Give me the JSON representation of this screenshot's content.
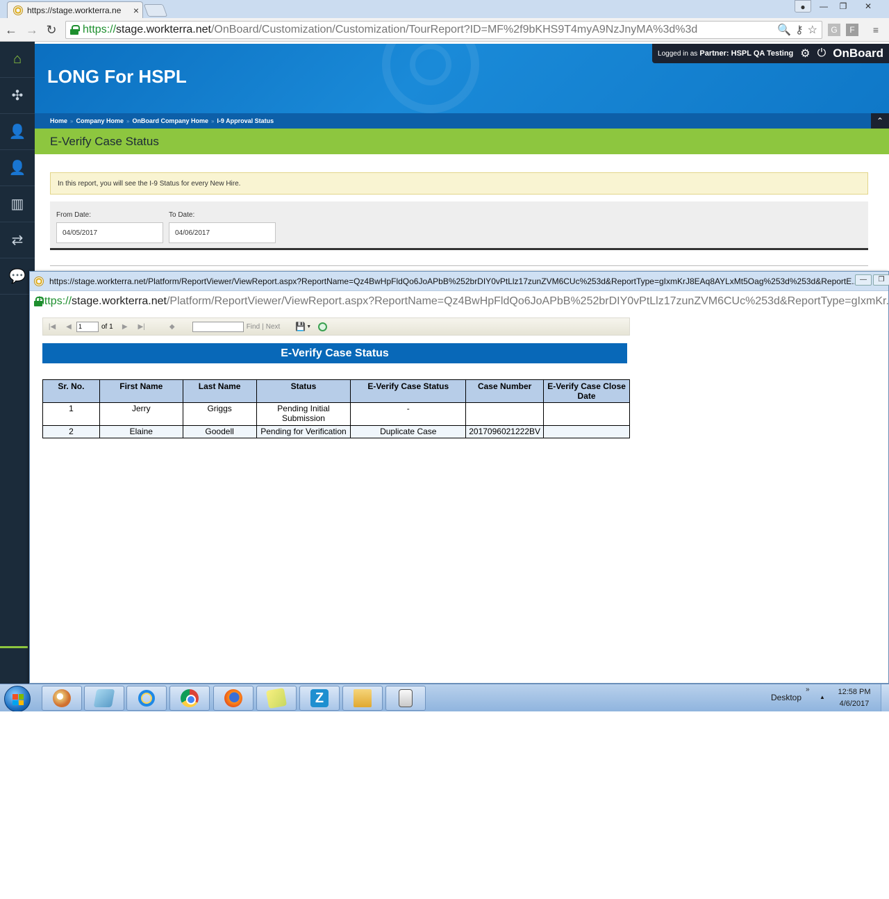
{
  "browser": {
    "tab_title": "https://stage.workterra.ne",
    "tab_close": "×",
    "url_scheme": "https://",
    "url_host": "stage.workterra.net",
    "url_path": "/OnBoard/Customization/Customization/TourReport?ID=MF%2f9bKHS9T4myA9NzJnyMA%3d%3d",
    "nav_back": "←",
    "nav_forward": "→",
    "nav_reload": "↻",
    "zoom_icon": "🔍",
    "key_icon": "⚷",
    "star_icon": "☆",
    "ext1_label": "G",
    "ext2_label": "F",
    "menu_icon": "≡",
    "win_min": "—",
    "win_max": "❐",
    "win_close": "✕"
  },
  "sidebar": {
    "items": [
      {
        "icon": "home-icon",
        "glyph": "⌂"
      },
      {
        "icon": "puzzle-icon",
        "glyph": "✣"
      },
      {
        "icon": "user-add-icon",
        "glyph": "👤"
      },
      {
        "icon": "user-icon",
        "glyph": "👤"
      },
      {
        "icon": "bar-chart-icon",
        "glyph": "▥"
      },
      {
        "icon": "transfer-icon",
        "glyph": "⇄"
      },
      {
        "icon": "chat-icon",
        "glyph": "💬"
      }
    ]
  },
  "header": {
    "company_title": "LONG For HSPL",
    "login_prefix": "Logged in as",
    "partner_label": "Partner:",
    "partner_name": "HSPL QA Testing",
    "gear_glyph": "⚙",
    "power_glyph": "⏻",
    "brand": "OnBoard"
  },
  "breadcrumb": {
    "items": [
      "Home",
      "Company Home",
      "OnBoard Company Home",
      "I-9 Approval Status"
    ],
    "separator": "»",
    "collapse_glyph": "⌃"
  },
  "page": {
    "title": "E-Verify Case Status",
    "info_text": "In this report, you will see the I-9 Status for every New Hire.",
    "from_label": "From Date:",
    "from_value": "04/05/2017",
    "to_label": "To Date:",
    "to_value": "04/06/2017"
  },
  "popup": {
    "window_title": "https://stage.workterra.net/Platform/ReportViewer/ViewReport.aspx?ReportName=Qz4BwHpFldQo6JoAPbB%252brDIY0vPtLlz17zunZVM6CUc%253d&ReportType=gIxmKrJ8EAq8AYLxMt5Oag%253d%253d&ReportE...",
    "url_scheme": "https://",
    "url_host": "stage.workterra.net",
    "url_path": "/Platform/ReportViewer/ViewReport.aspx?ReportName=Qz4BwHpFldQo6JoAPbB%252brDIY0vPtLlz17zunZVM6CUc%253d&ReportType=gIxmKr...",
    "min_glyph": "—",
    "max_glyph": "❐"
  },
  "report_viewer": {
    "first_glyph": "|◀",
    "prev_glyph": "◀",
    "page_value": "1",
    "of_text": "of 1",
    "next_glyph": "▶",
    "last_glyph": "▶|",
    "back_glyph": "◆",
    "find_label": "Find",
    "pipe": "|",
    "next_label": "Next",
    "export_glyph": "💾",
    "export_arrow": "▼"
  },
  "report": {
    "title": "E-Verify Case Status",
    "columns": [
      "Sr. No.",
      "First Name",
      "Last Name",
      "Status",
      "E-Verify Case Status",
      "Case Number",
      "E-Verify Case Close Date"
    ],
    "rows": [
      [
        "1",
        "Jerry",
        "Griggs",
        "Pending Initial Submission",
        "-",
        "",
        ""
      ],
      [
        "2",
        "Elaine",
        "Goodell",
        "Pending for Verification",
        "Duplicate Case",
        "2017096021222BV",
        ""
      ]
    ]
  },
  "taskbar": {
    "z_label": "Z",
    "desktop_label": "Desktop",
    "chevron": "»",
    "tray_up": "▲",
    "time": "12:58 PM",
    "date": "4/6/2017"
  }
}
